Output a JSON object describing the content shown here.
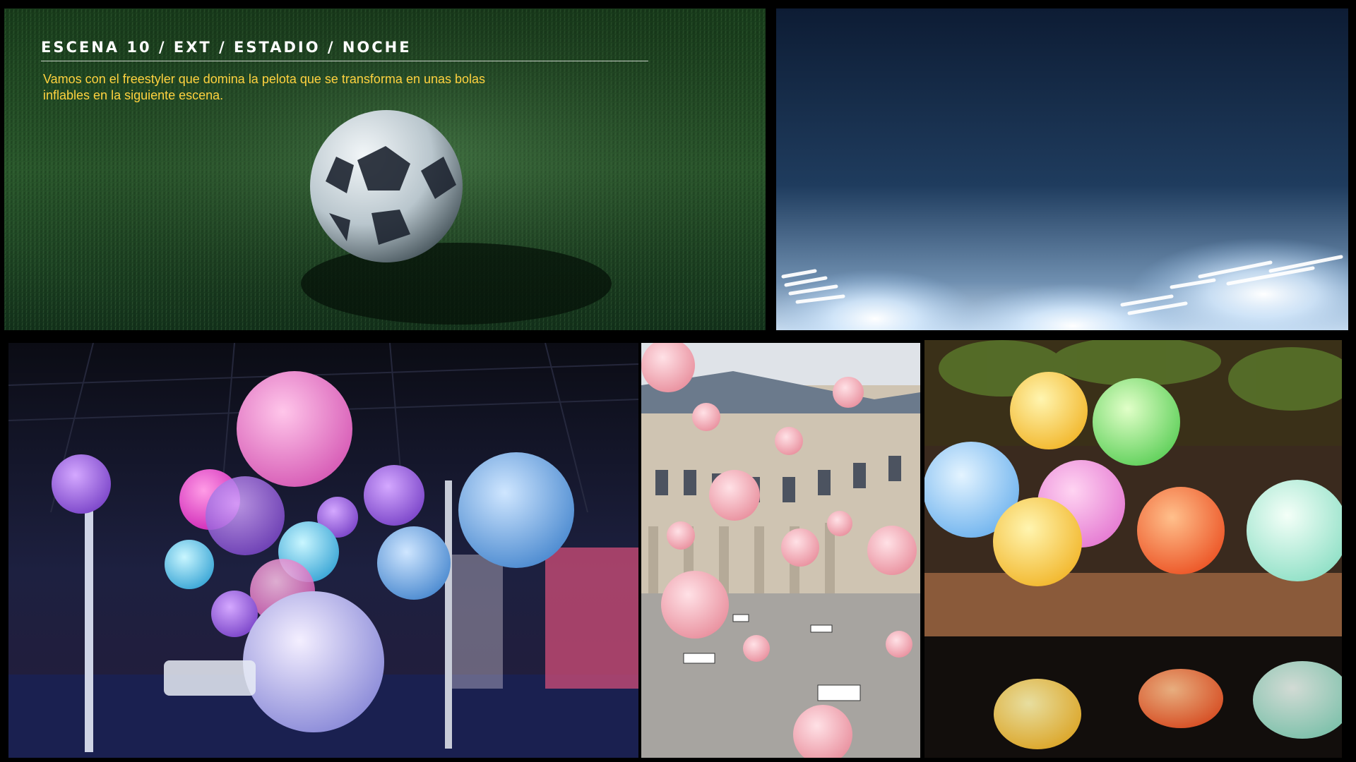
{
  "slide": {
    "title": "ESCENA 10 / EXT / ESTADIO / NOCHE",
    "description": "Vamos con el freestyler que domina la pelota que  se transforma en unas bolas inflables en la siguiente escena."
  },
  "colors": {
    "background": "#000000",
    "title_text": "#ffffff",
    "description_text": "#ffd23f",
    "grass": "#1e3a1f",
    "night_sky": "#16304d"
  },
  "images": [
    {
      "name": "soccer-ball-on-grass"
    },
    {
      "name": "stadium-floodlights-night-sky"
    },
    {
      "name": "glowing-inflatable-spheres-event-hall"
    },
    {
      "name": "pink-balloons-palais-royal"
    },
    {
      "name": "glowing-sphere-lamps-pool"
    }
  ]
}
